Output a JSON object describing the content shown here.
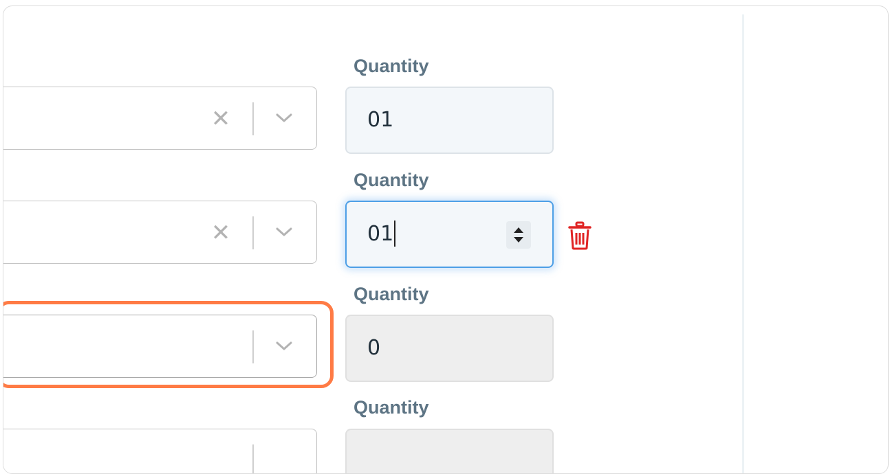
{
  "form": {
    "rows": [
      {
        "quantity_label": "Quantity",
        "quantity_value": "01",
        "clear_icon": "close-icon",
        "dropdown_icon": "chevron-down-icon"
      },
      {
        "quantity_label": "Quantity",
        "quantity_value": "01",
        "clear_icon": "close-icon",
        "dropdown_icon": "chevron-down-icon",
        "delete_icon": "trash-icon"
      },
      {
        "quantity_label": "Quantity",
        "quantity_value": "0",
        "dropdown_icon": "chevron-down-icon"
      },
      {
        "quantity_label": "Quantity",
        "quantity_value": ""
      }
    ]
  },
  "colors": {
    "label": "#5d7484",
    "highlight": "#ff7b45",
    "focus": "#4d9fe6",
    "danger": "#e02424"
  }
}
